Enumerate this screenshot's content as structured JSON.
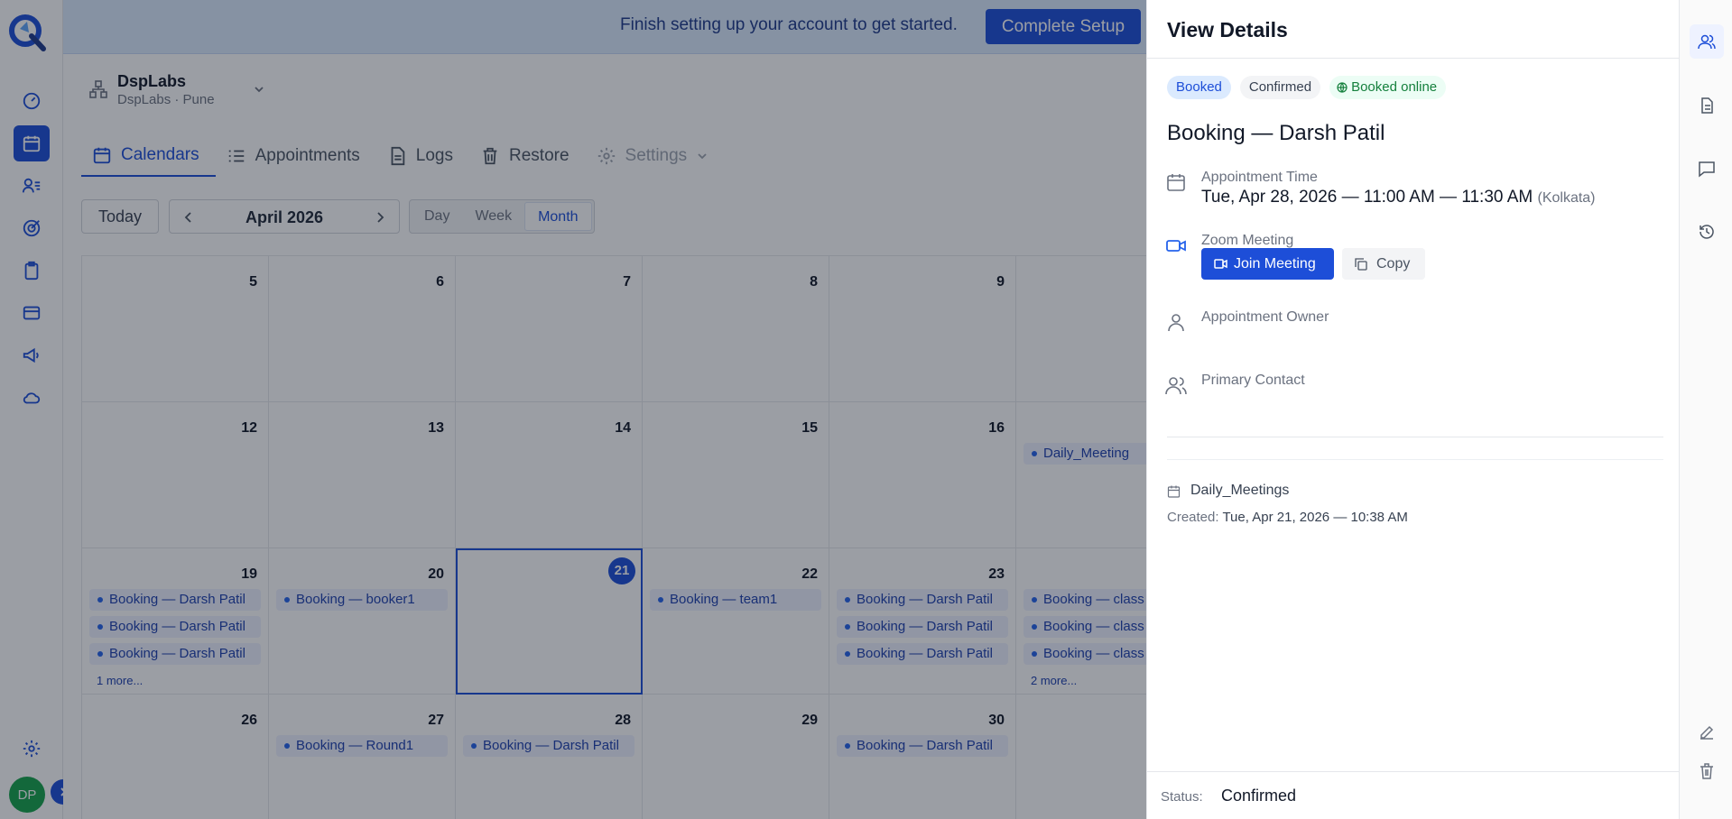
{
  "banner": {
    "text": "Finish setting up your account to get started.",
    "button": "Complete Setup"
  },
  "location": {
    "name": "DspLabs",
    "sub": "DspLabs · Pune"
  },
  "tabs": [
    {
      "label": "Calendars",
      "icon": "calendar-icon",
      "active": true
    },
    {
      "label": "Appointments",
      "icon": "list-icon"
    },
    {
      "label": "Logs",
      "icon": "document-icon"
    },
    {
      "label": "Restore",
      "icon": "trash-icon"
    },
    {
      "label": "Settings",
      "icon": "gear-icon"
    }
  ],
  "toolbar": {
    "today": "Today",
    "month": "April 2026",
    "views": [
      "Day",
      "Week",
      "Month"
    ],
    "active_view": "Month"
  },
  "calendar": {
    "weeks": [
      {
        "days": [
          {
            "num": "5",
            "events": []
          },
          {
            "num": "6",
            "events": []
          },
          {
            "num": "7",
            "events": []
          },
          {
            "num": "8",
            "events": []
          },
          {
            "num": "9",
            "events": []
          },
          {
            "num": "",
            "events": []
          }
        ]
      },
      {
        "days": [
          {
            "num": "12",
            "events": []
          },
          {
            "num": "13",
            "events": []
          },
          {
            "num": "14",
            "events": []
          },
          {
            "num": "15",
            "events": []
          },
          {
            "num": "16",
            "events": []
          },
          {
            "num": "",
            "events": [
              "Daily_Meeting"
            ]
          }
        ]
      },
      {
        "days": [
          {
            "num": "19",
            "events": [
              "Booking — Darsh Patil",
              "Booking — Darsh Patil",
              "Booking — Darsh Patil"
            ],
            "more": "1 more..."
          },
          {
            "num": "20",
            "events": [
              "Booking — booker1"
            ]
          },
          {
            "num": "21",
            "events": [],
            "today": true
          },
          {
            "num": "22",
            "events": [
              "Booking — team1"
            ]
          },
          {
            "num": "23",
            "events": [
              "Booking — Darsh Patil",
              "Booking — Darsh Patil",
              "Booking — Darsh Patil"
            ]
          },
          {
            "num": "",
            "events": [
              "Booking — class",
              "Booking — class",
              "Booking — class"
            ],
            "more": "2 more..."
          }
        ]
      },
      {
        "days": [
          {
            "num": "26",
            "events": []
          },
          {
            "num": "27",
            "events": [
              "Booking — Round1"
            ]
          },
          {
            "num": "28",
            "events": [
              "Booking — Darsh Patil"
            ]
          },
          {
            "num": "29",
            "events": []
          },
          {
            "num": "30",
            "events": [
              "Booking — Darsh Patil"
            ]
          },
          {
            "num": "",
            "events": []
          }
        ]
      }
    ]
  },
  "drawer": {
    "title": "View Details",
    "badges": {
      "booked": "Booked",
      "confirmed": "Confirmed",
      "online": "Booked online"
    },
    "booking_title": "Booking — Darsh Patil",
    "appointment_time_label": "Appointment Time",
    "appointment_time_value": "Tue, Apr 28, 2026 — 11:00 AM — 11:30 AM",
    "timezone": "(Kolkata)",
    "zoom_label": "Zoom Meeting",
    "join_button": "Join Meeting",
    "copy_button": "Copy",
    "owner_label": "Appointment Owner",
    "contact_label": "Primary Contact",
    "calendar_name": "Daily_Meetings",
    "created_label": "Created:",
    "created_value": "Tue, Apr 21, 2026 — 10:38 AM",
    "status_label": "Status:",
    "status_value": "Confirmed"
  },
  "user": {
    "initials": "DP"
  },
  "colors": {
    "primary": "#1d4ed8",
    "banner_bg": "#dbeafe",
    "event_bg": "#eef2ff",
    "success": "#15803d"
  }
}
